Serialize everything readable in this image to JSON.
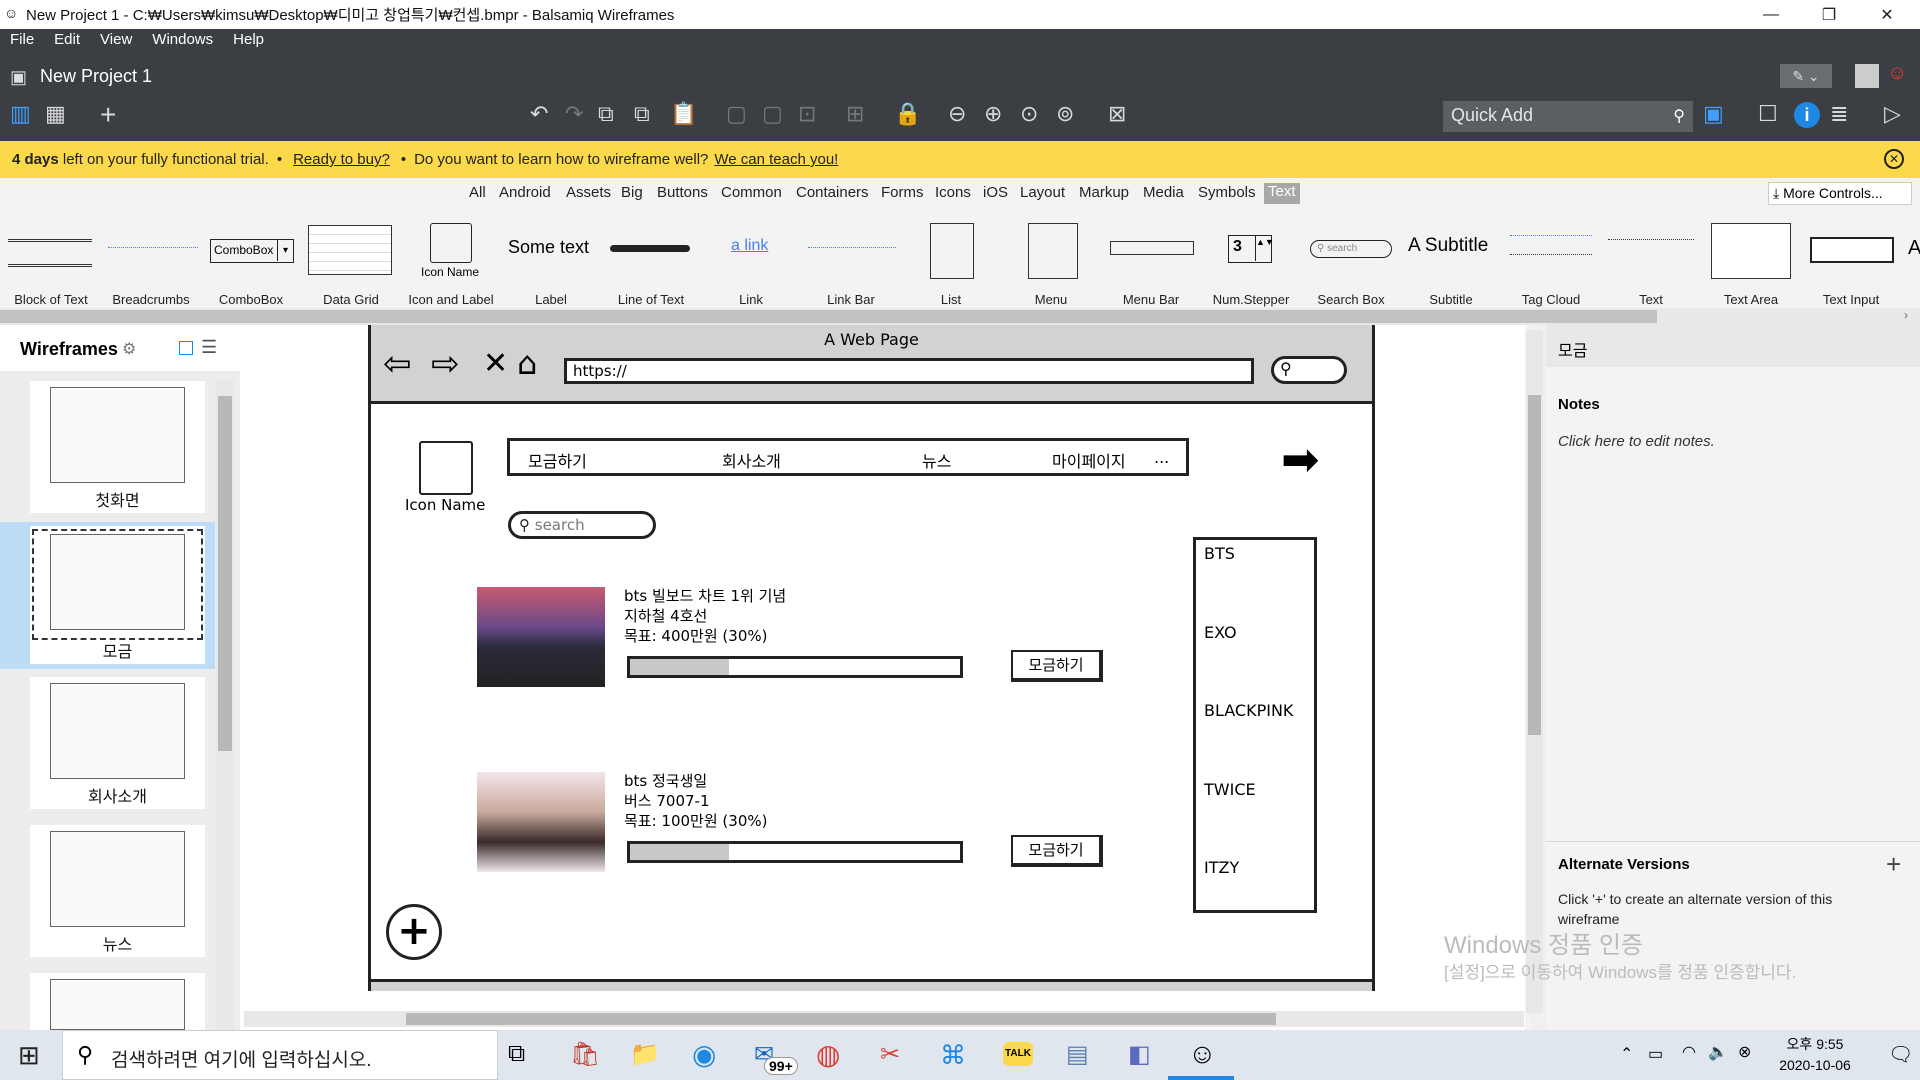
{
  "window": {
    "title": "New Project 1 - C:₩Users₩kimsu₩Desktop₩디미고 창업특기₩컨셉.bmpr - Balsamiq Wireframes",
    "minimize": "—",
    "restore": "❐",
    "close": "✕"
  },
  "menu": [
    "File",
    "Edit",
    "View",
    "Windows",
    "Help"
  ],
  "project": {
    "title": "New Project 1"
  },
  "quick_add": {
    "placeholder": "Quick Add"
  },
  "trial": {
    "days": "4 days",
    "text1": " left on your fully functional trial.",
    "bullet": "•",
    "ready_link": "Ready to buy?",
    "text2": "Do you want to learn how to wireframe well?",
    "teach_link": "We can teach you!"
  },
  "categories": [
    "All",
    "Android",
    "Assets",
    "Big",
    "Buttons",
    "Common",
    "Containers",
    "Forms",
    "Icons",
    "iOS",
    "Layout",
    "Markup",
    "Media",
    "Symbols",
    "Text"
  ],
  "active_category": "Text",
  "more_controls": "More Controls...",
  "library": [
    "Block of Text",
    "Breadcrumbs",
    "ComboBox",
    "Data Grid",
    "Icon and Label",
    "Label",
    "Line of Text",
    "Link",
    "Link Bar",
    "List",
    "Menu",
    "Menu Bar",
    "Num.Stepper",
    "Search Box",
    "Subtitle",
    "Tag Cloud",
    "Text",
    "Text Area",
    "Text Input"
  ],
  "library_previews": {
    "combobox": "ComboBox",
    "icon_name": "Icon Name",
    "label": "Some text",
    "link": "a link",
    "stepper": "3",
    "search": "search",
    "subtitle": "A Subtitle",
    "a": "A"
  },
  "wireframes_panel": {
    "title": "Wireframes",
    "items": [
      {
        "label": "첫화면"
      },
      {
        "label": "모금"
      },
      {
        "label": "회사소개"
      },
      {
        "label": "뉴스"
      }
    ]
  },
  "mockup": {
    "page_title": "A Web Page",
    "url": "https://",
    "icon_label": "Icon Name",
    "search_placeholder": "search",
    "nav": [
      "모금하기",
      "회사소개",
      "뉴스",
      "마이페이지",
      "..."
    ],
    "campaigns": [
      {
        "title": "bts 빌보드 차트 1위 기념",
        "location": "지하철 4호선",
        "goal": "목표: 400만원 (30%)",
        "progress": 0.3,
        "button": "모금하기"
      },
      {
        "title": "bts 정국생일",
        "location": "버스 7007-1",
        "goal": "목표: 100만원 (30%)",
        "progress": 0.3,
        "button": "모금하기"
      }
    ],
    "groups": [
      "BTS",
      "EXO",
      "BLACKPINK",
      "TWICE",
      "ITZY"
    ],
    "add_button": "+"
  },
  "right_panel": {
    "title": "모금",
    "notes_heading": "Notes",
    "notes_placeholder": "Click here to edit notes.",
    "alt_heading": "Alternate Versions",
    "alt_text": "Click '+' to create an alternate version of this wireframe"
  },
  "watermark": {
    "line1": "Windows 정품 인증",
    "line2": "[설정]으로 이동하여 Windows를 정품 인증합니다."
  },
  "taskbar": {
    "search_placeholder": "검색하려면 여기에 입력하십시오.",
    "mail_badge": "99+",
    "kakao": "TALK",
    "time": "오후 9:55",
    "date": "2020-10-06"
  },
  "colors": {
    "accent_blue": "#1e88e5",
    "trial_yellow": "#fbd94a",
    "header_dark": "#3b3f44",
    "selected_thumb": "#bcdcf7"
  }
}
